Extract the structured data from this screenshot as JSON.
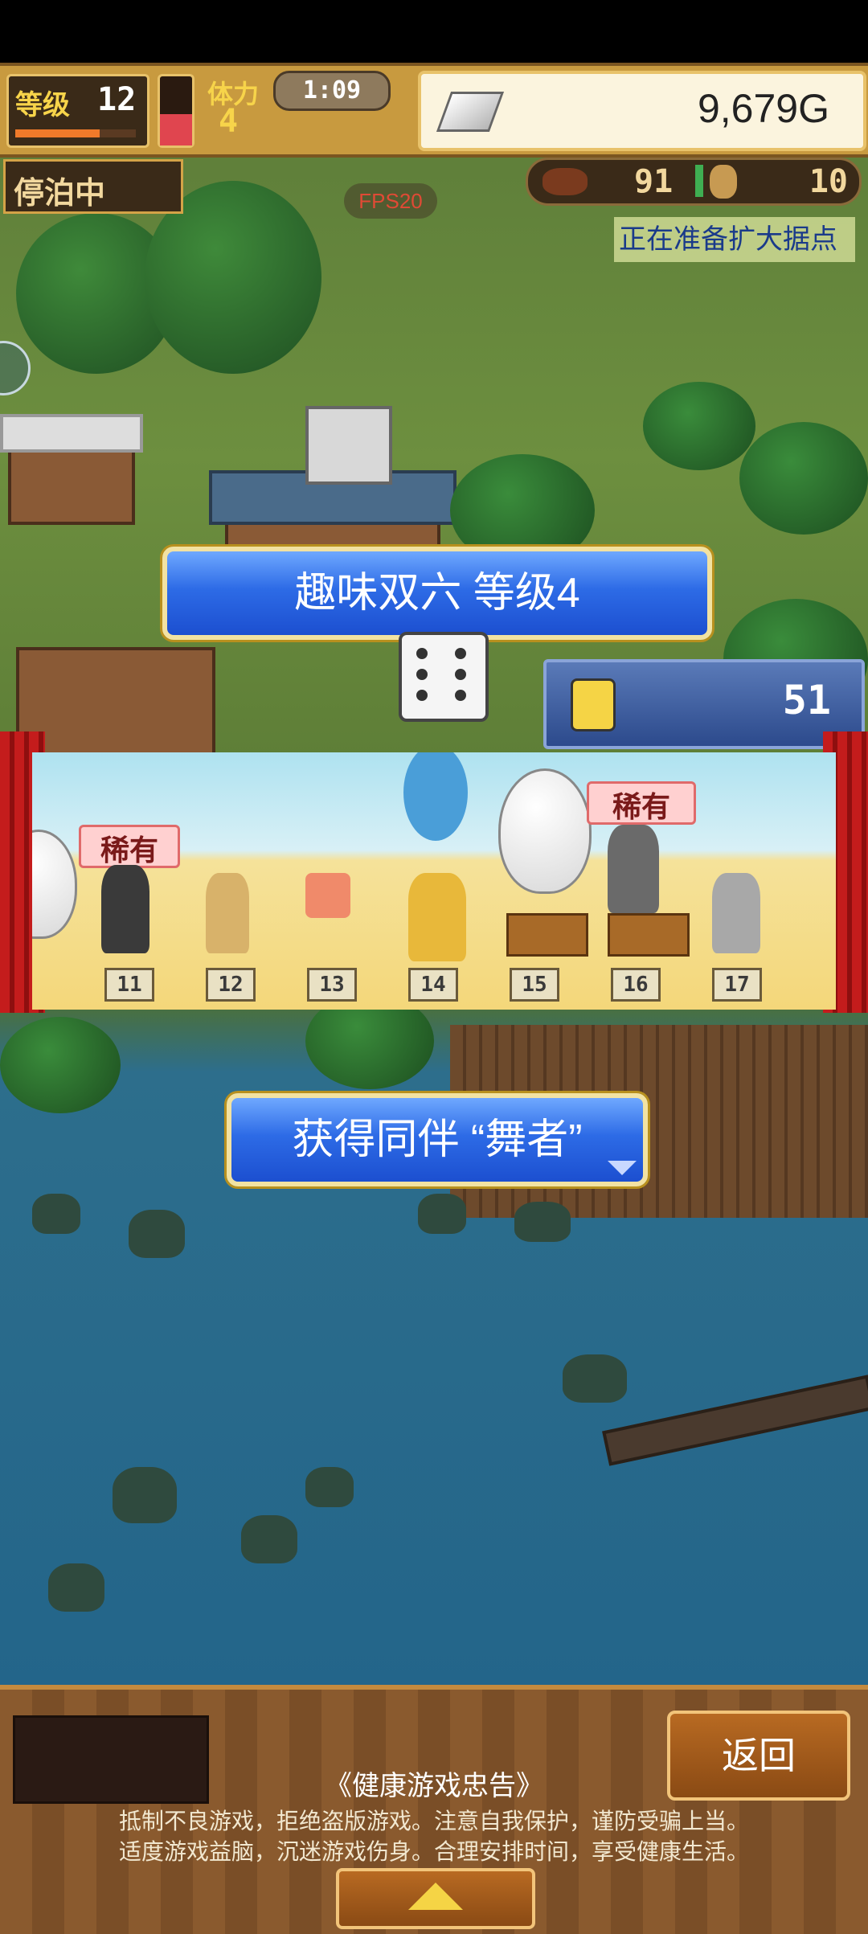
{
  "hud": {
    "level_label": "等级",
    "level_value": "12",
    "level_progress": 0.7,
    "health_level": 0.45,
    "stamina_label": "体力",
    "stamina_value": "4",
    "timer": "1:09",
    "gold": "9,679G"
  },
  "status": {
    "anchor_label": "停泊中",
    "fps": "FPS20",
    "food_value": "91",
    "wood_value": "10",
    "expand_status": "正在准备扩大据点"
  },
  "event": {
    "title": "趣味双六 等级4",
    "counter_value": "51",
    "rare_tag_1": "稀有",
    "rare_tag_2": "稀有",
    "tiles": [
      "11",
      "12",
      "13",
      "14",
      "15",
      "16",
      "17"
    ],
    "companion_message": "获得同伴 “舞者”"
  },
  "bottom": {
    "back_label": "返回",
    "advisory_title": "《健康游戏忠告》",
    "advisory_line_1": "抵制不良游戏，拒绝盗版游戏。注意自我保护，谨防受骗上当。",
    "advisory_line_2": "适度游戏益脑，沉迷游戏伤身。合理安排时间，享受健康生活。"
  },
  "colors": {
    "banner_blue": "#2d6be6",
    "gold_frame": "#e8c26a",
    "fps_red": "#e04a35"
  }
}
